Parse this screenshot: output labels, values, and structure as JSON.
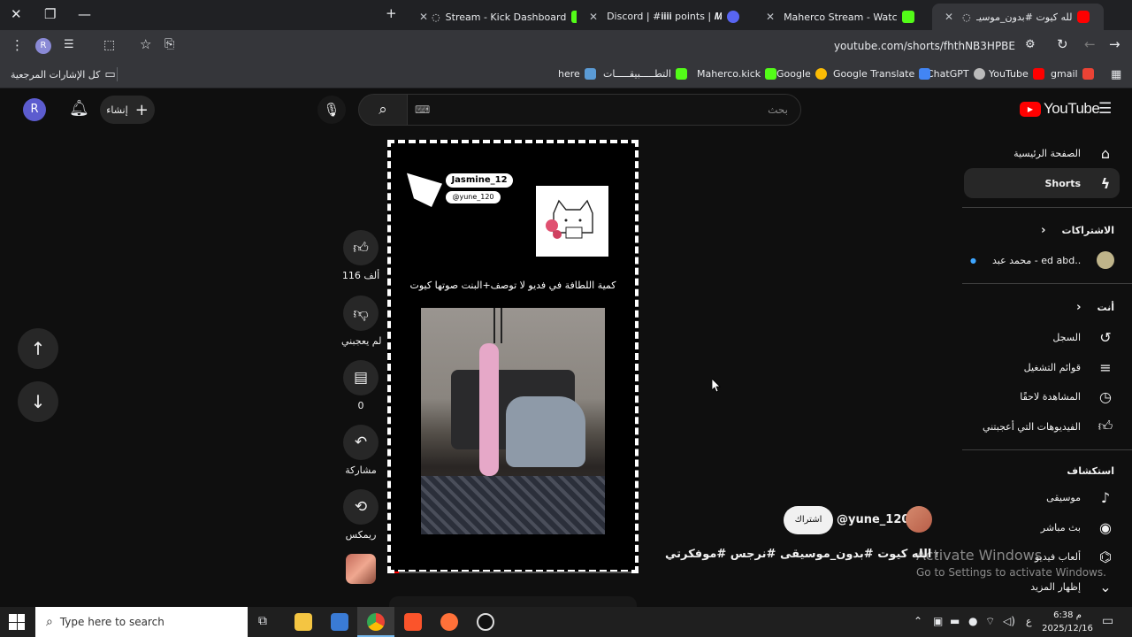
{
  "tabs": [
    {
      "title": "Stream - Kick Dashboard",
      "color": "#53fc18"
    },
    {
      "title": "Discord | #𝐢𝐢𝐢𝐢 points | 𝑴𝑨𝑯𝑬",
      "color": "#5865f2"
    },
    {
      "title": "Maherco Stream - Watch Live o",
      "color": "#53fc18"
    },
    {
      "title": "مشاء الله كيوت #بدون_موسيـ",
      "color": "#ff0000"
    }
  ],
  "address": {
    "url": "youtube.com/shorts/fhthNB3HPBE"
  },
  "bookmarks": [
    {
      "label": "gmail"
    },
    {
      "label": "YouTube"
    },
    {
      "label": "ChatGPT"
    },
    {
      "label": "Google Translate"
    },
    {
      "label": "Google"
    },
    {
      "label": "Maherco.kick"
    },
    {
      "label": "التطـــــبيقـــــات"
    },
    {
      "label": "here"
    },
    {
      "label": "كل الإشارات المرجعية"
    }
  ],
  "header": {
    "logo": "YouTube",
    "search_placeholder": "بحث",
    "create_label": "إنشاء",
    "avatar_letter": "R"
  },
  "sidebar": {
    "home": "الصفحة الرئيسية",
    "shorts": "Shorts",
    "subs_title": "الاشتراكات",
    "sub_channel": "محمد عبد - ed abd...",
    "you_title": "أنت",
    "history": "السجل",
    "playlists": "قوائم التشغيل",
    "watch_later": "المشاهدة لاحقًا",
    "liked": "الفيديوهات التي أعجبتني",
    "explore_title": "استكشاف",
    "music": "موسيقى",
    "live": "بث مباشر",
    "gaming": "ألعاب فيديو",
    "show_more": "إظهار المزيد"
  },
  "short": {
    "overlay_name": "Jasmine_12",
    "overlay_handle": "@yune_120",
    "caption": "كمية اللطافة في فديو لا توصف+البنت صوتها كيوت",
    "channel": "@yune_120",
    "subscribe": "اشتراك",
    "title": "مشاء الله كيوت #بدون_موسيقى #نرجس #موفكرتي ..."
  },
  "actions": {
    "likes": "116 ألف",
    "dislike": "لم يعجبني",
    "comments": "0",
    "share": "مشاركة",
    "remix": "ريمكس"
  },
  "watermark": {
    "line1": "Activate Windows",
    "line2": "Go to Settings to activate Windows."
  },
  "taskbar": {
    "search_placeholder": "Type here to search",
    "time": "6:38 م",
    "date": "2025/12/16",
    "lang": "ع"
  }
}
